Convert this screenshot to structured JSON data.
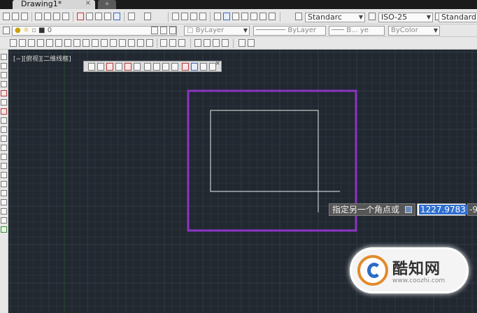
{
  "document_tab": {
    "title": "Drawing1*",
    "close": "×",
    "new_tab": "+"
  },
  "toolbar_top": {
    "text_style": "Standarc",
    "dim_style": "ISO-25",
    "table_style": "Standard"
  },
  "toolbar_layers": {
    "layer": "0",
    "color": "ByLayer",
    "linetype": "ByLayer",
    "lineweight": "B... ye",
    "plot_style": "ByColor"
  },
  "viewport_label": "[−][俯视][二维线框]",
  "command_prompt": {
    "text": "指定另一个角点或",
    "x_value": "1227.9783",
    "y_value_partial": "-9"
  },
  "watermark": {
    "brand": "酷知网",
    "url": "www.coozhi.com"
  },
  "colors": {
    "canvas_bg": "#212830",
    "grid_minor": "#2a323d",
    "grid_major": "#313a46",
    "selection_purple": "#8a35c2",
    "rubberband": "#ececec",
    "accent_blue": "#2e6ed0"
  }
}
